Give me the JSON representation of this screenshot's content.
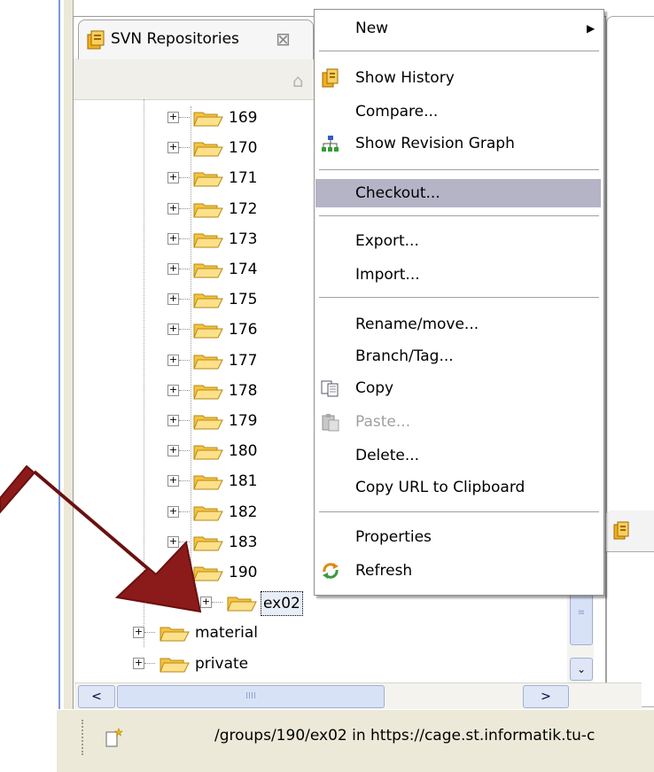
{
  "view": {
    "tab_title": "SVN Repositories",
    "close_glyph": "⊠"
  },
  "tree": {
    "revisions": [
      "169",
      "170",
      "171",
      "172",
      "173",
      "174",
      "175",
      "176",
      "177",
      "178",
      "179",
      "180",
      "181",
      "182",
      "183",
      "190"
    ],
    "child": "ex02",
    "siblings": [
      "material",
      "private"
    ],
    "expander_glyph": "+"
  },
  "menu": {
    "items": [
      {
        "label": "New",
        "has_submenu": true
      },
      {
        "label": "Show History",
        "icon": "history-icon"
      },
      {
        "label": "Compare..."
      },
      {
        "label": "Show Revision Graph",
        "icon": "revision-graph-icon"
      },
      {
        "label": "Checkout...",
        "highlighted": true
      },
      {
        "label": "Export..."
      },
      {
        "label": "Import..."
      },
      {
        "label": "Rename/move..."
      },
      {
        "label": "Branch/Tag..."
      },
      {
        "label": "Copy",
        "icon": "copy-icon"
      },
      {
        "label": "Paste...",
        "icon": "paste-icon",
        "disabled": true
      },
      {
        "label": "Delete..."
      },
      {
        "label": "Copy URL to Clipboard"
      },
      {
        "label": "Properties"
      },
      {
        "label": "Refresh",
        "icon": "refresh-icon"
      }
    ],
    "submenu_arrow": "▶"
  },
  "scroll": {
    "left": "<",
    "right": ">",
    "grip": "IIII",
    "vgrip": "≡",
    "down": "⌄"
  },
  "status": {
    "text": "/groups/190/ex02 in https://cage.st.informatik.tu-c"
  },
  "colors": {
    "highlight": "#b5b3c6",
    "arrow": "#8b1a1a",
    "folder": "#f5c342"
  }
}
